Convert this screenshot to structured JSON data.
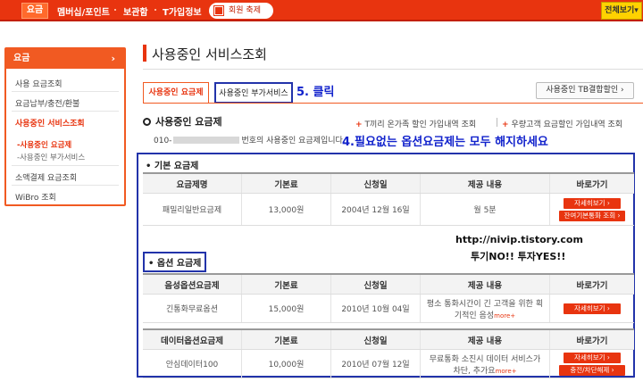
{
  "topnav": {
    "home": "요금",
    "items": [
      "멤버십/포인트",
      "보관함",
      "T가입정보"
    ],
    "event": "회원 축제",
    "all_menu": "전체보기▾"
  },
  "sidebar": {
    "header": "요금",
    "header_arrow": "›",
    "links": [
      "사용 요금조회",
      "요금납부/충전/환불",
      "사용중인 서비스조회"
    ],
    "subs": [
      "-사용중인 요금제",
      "-사용중인 부가서비스"
    ],
    "links2": [
      "소액결제 요금조회",
      "WiBro 조회"
    ]
  },
  "page": {
    "title": "사용중인 서비스조회",
    "tab_active": "사용중인 요금제",
    "tab_other": "사용중인 부가서비스",
    "annotation5": "5. 클릭",
    "tb_button": "사용중인 TB결합할인 ›",
    "section_title": "사용중인 요금제",
    "rlink1": "T끼리 온가족 할인 가입내역 조회",
    "rlink2": "우량고객 요금할인 가입내역 조회",
    "phone_prefix": "010-",
    "phone_suffix": "번호의 사용중인 요금제입니다.",
    "annotation4": "4.필요없는 옵션요금제는 모두 해지하세요",
    "basic_label": "• 기본 요금제",
    "option_label": "• 옵션 요금제",
    "blog": "http://nivip.tistory.com",
    "slogan": "투기NO!! 투자YES!!"
  },
  "basic_table": {
    "headers": [
      "요금제명",
      "기본료",
      "신청일",
      "제공 내용",
      "바로가기"
    ],
    "row": {
      "name": "패밀리일반요금제",
      "fee": "13,000원",
      "date": "2004년 12월 16일",
      "content": "월 5분",
      "btn1": "자세히보기 ›",
      "btn2": "잔여기본통화 조회 ›"
    }
  },
  "option_table1": {
    "headers": [
      "음성옵션요금제",
      "기본료",
      "신청일",
      "제공 내용",
      "바로가기"
    ],
    "row": {
      "name": "긴통화무료옵션",
      "fee": "15,000원",
      "date": "2010년 10월 04일",
      "content": "평소 통화시간이 긴 고객을 위한 획기적인 음성",
      "more": "more+",
      "btn1": "자세히보기 ›"
    }
  },
  "option_table2": {
    "headers": [
      "데이터옵션요금제",
      "기본료",
      "신청일",
      "제공 내용",
      "바로가기"
    ],
    "row": {
      "name": "안심데이터100",
      "fee": "10,000원",
      "date": "2010년 07월 12일",
      "content": "무료통화 소진시 데이터 서비스가 차단, 추가요",
      "more": "more+",
      "btn1": "자세히보기 ›",
      "btn2": "충전/차단해제 ›"
    }
  }
}
